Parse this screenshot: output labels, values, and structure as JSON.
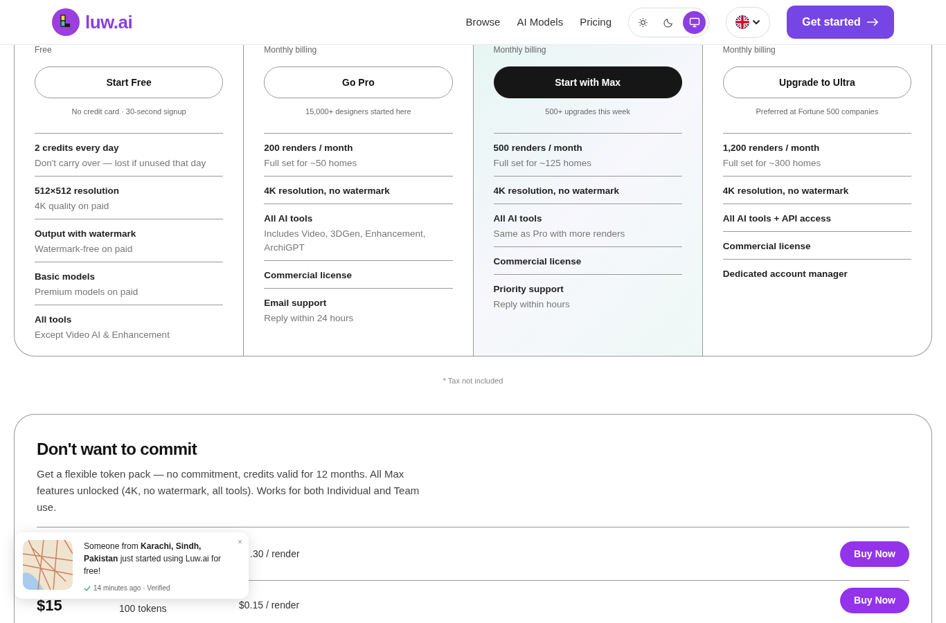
{
  "navbar": {
    "logo_text": "luw.ai",
    "links": [
      "Browse",
      "AI Models",
      "Pricing"
    ],
    "theme_options": [
      {
        "kind": "light",
        "selected": false
      },
      {
        "kind": "dark",
        "selected": false
      },
      {
        "kind": "system",
        "selected": true
      }
    ],
    "cta": "Get started"
  },
  "plans": [
    {
      "billing": "Free",
      "button": "Start Free",
      "highlighted": false,
      "note": "No credit card · 30-second signup",
      "features": [
        {
          "title": "2 credits every day",
          "detail": "Don't carry over — lost if unused that day"
        },
        {
          "title": "512×512 resolution",
          "detail": "4K quality on paid"
        },
        {
          "title": "Output with watermark",
          "detail": "Watermark-free on paid"
        },
        {
          "title": "Basic models",
          "detail": "Premium models on paid"
        },
        {
          "title": "All tools",
          "detail": "Except Video AI & Enhancement"
        }
      ]
    },
    {
      "billing": "Monthly billing",
      "button": "Go Pro",
      "highlighted": false,
      "note": "15,000+ designers started here",
      "features": [
        {
          "title": "200 renders / month",
          "detail": "Full set for ~50 homes"
        },
        {
          "title": "4K resolution, no watermark"
        },
        {
          "title": "All AI tools",
          "detail": "Includes Video, 3DGen, Enhancement, ArchiGPT"
        },
        {
          "title": "Commercial license"
        },
        {
          "title": "Email support",
          "detail": "Reply within 24 hours"
        }
      ]
    },
    {
      "billing": "Monthly billing",
      "button": "Start with Max",
      "highlighted": true,
      "note": "500+ upgrades this week",
      "features": [
        {
          "title": "500 renders / month",
          "detail": "Full set for ~125 homes"
        },
        {
          "title": "4K resolution, no watermark"
        },
        {
          "title": "All AI tools",
          "detail": "Same as Pro with more renders"
        },
        {
          "title": "Commercial license"
        },
        {
          "title": "Priority support",
          "detail": "Reply within hours"
        }
      ]
    },
    {
      "billing": "Monthly billing",
      "button": "Upgrade to Ultra",
      "highlighted": false,
      "note": "Preferred at Fortune 500 companies",
      "features": [
        {
          "title": "1,200 renders / month",
          "detail": "Full set for ~300 homes"
        },
        {
          "title": "4K resolution, no watermark"
        },
        {
          "title": "All AI tools + API access"
        },
        {
          "title": "Commercial license"
        },
        {
          "title": "Dedicated account manager"
        }
      ]
    }
  ],
  "tax_note": "* Tax not included",
  "token_packs": {
    "title": "Don't want to commit",
    "description": "Get a flexible token pack — no commitment, credits valid for 12 months. All Max features unlocked (4K, no watermark, all tools). Works for both Individual and Team use.",
    "rows": [
      {
        "per_render": ".30 / render",
        "button": "Buy Now"
      },
      {
        "price": "$15",
        "tokens": "100 tokens",
        "per_render": "$0.15 / render",
        "button": "Buy Now"
      }
    ]
  },
  "toast": {
    "message": "Someone from **Karachi, Sindh, Pakistan** just started using Luw.ai for free!",
    "close": "×",
    "meta": "14 minutes ago · Verified"
  }
}
